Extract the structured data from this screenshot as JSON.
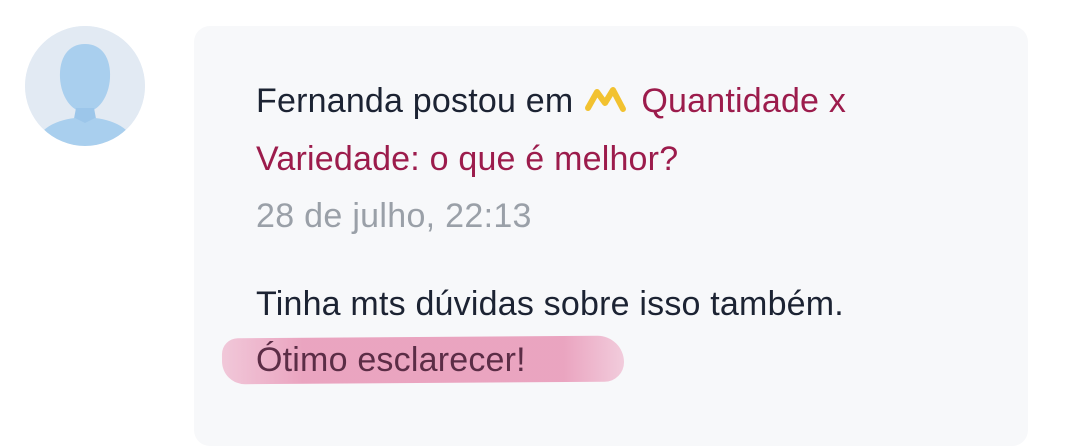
{
  "post": {
    "author_text": "Fernanda postou em",
    "topic_icon": "yellow-zigzag-icon",
    "topic_title": "Quantidade x Variedade: o que é melhor?",
    "timestamp": "28 de julho, 22:13",
    "comment_line1": "Tinha mts dúvidas sobre isso também.",
    "comment_line2": "Ótimo esclarecer!"
  },
  "colors": {
    "topic_link": "#9c1c4c",
    "text": "#1c2333",
    "timestamp": "#9aa0a8",
    "highlight": "#e896b6",
    "card_bg": "#f7f8fa",
    "avatar_bg": "#e2eaf3",
    "icon": "#f2c230"
  }
}
